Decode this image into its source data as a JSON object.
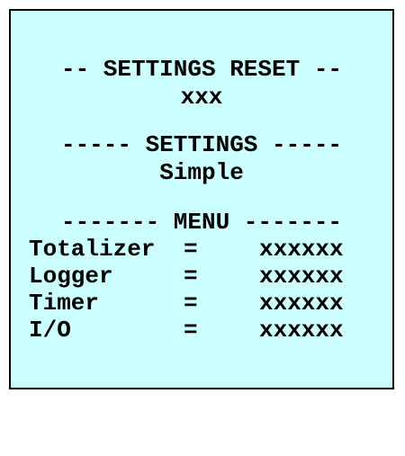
{
  "display": {
    "reset_header": "-- SETTINGS RESET --",
    "reset_value": "xxx",
    "settings_header": "----- SETTINGS -----",
    "settings_value": "Simple",
    "menu_header": "------- MENU -------",
    "menu_items": [
      {
        "label": "Totalizer",
        "sep": "=",
        "value": "xxxxxx"
      },
      {
        "label": "Logger",
        "sep": "=",
        "value": "xxxxxx"
      },
      {
        "label": "Timer",
        "sep": "=",
        "value": "xxxxxx"
      },
      {
        "label": "I/O",
        "sep": "=",
        "value": "xxxxxx"
      }
    ],
    "background_color": "#ccffff",
    "text_color": "#000000"
  }
}
